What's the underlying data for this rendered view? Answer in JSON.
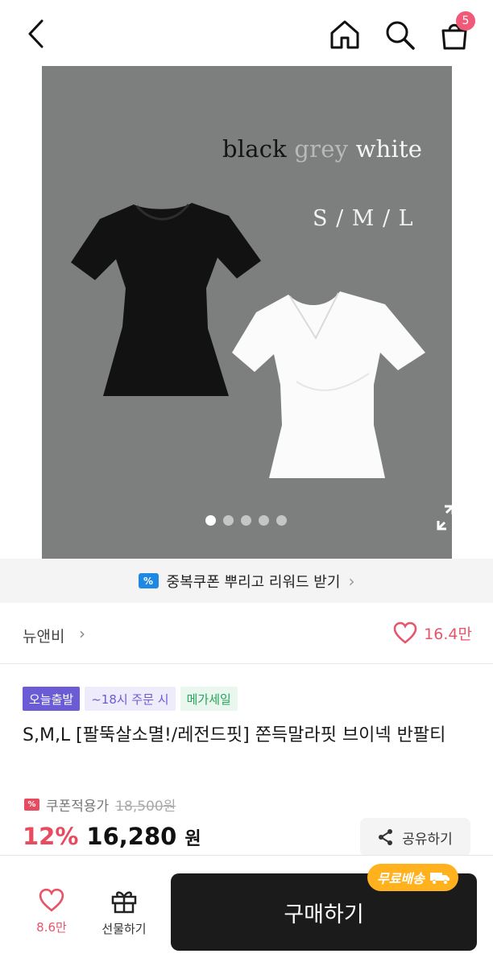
{
  "header": {
    "cart_count": "5"
  },
  "hero": {
    "colors": [
      "black",
      "grey",
      "white"
    ],
    "sizes": "S / M / L",
    "slide_count": 5,
    "active_slide": 1
  },
  "coupon_banner": {
    "text": "중복쿠폰 뿌리고 리워드 받기",
    "chevron": "›"
  },
  "brand": {
    "name": "뉴앤비",
    "chevron": "›",
    "likes": "16.4만"
  },
  "tags": {
    "today": "오늘출발",
    "time": "~18시 주문 시",
    "mega": "메가세일"
  },
  "product": {
    "title": "S,M,L [팔뚝살소멸!/레전드핏] 쫀득말라핏 브이넥 반팔티",
    "coupon_label": "쿠폰적용가",
    "original_price": "18,500원",
    "discount": "12%",
    "price": "16,280",
    "currency": "원"
  },
  "share": {
    "label": "공유하기"
  },
  "bottom": {
    "wish_count": "8.6만",
    "gift_label": "선물하기",
    "buy_label": "구매하기",
    "free_shipping": "무료배송"
  },
  "colors": {
    "accent_pink": "#e8546a",
    "badge": "#f05a78",
    "today_tag": "#6b5bd4",
    "mega_tag": "#27a35a",
    "free_ship": "#ffb21e",
    "buy_button": "#1b1b1b"
  },
  "icons": [
    "back-icon",
    "home-icon",
    "search-icon",
    "cart-icon",
    "expand-icon",
    "coupon-icon",
    "heart-icon",
    "share-icon",
    "gift-icon",
    "truck-icon"
  ]
}
